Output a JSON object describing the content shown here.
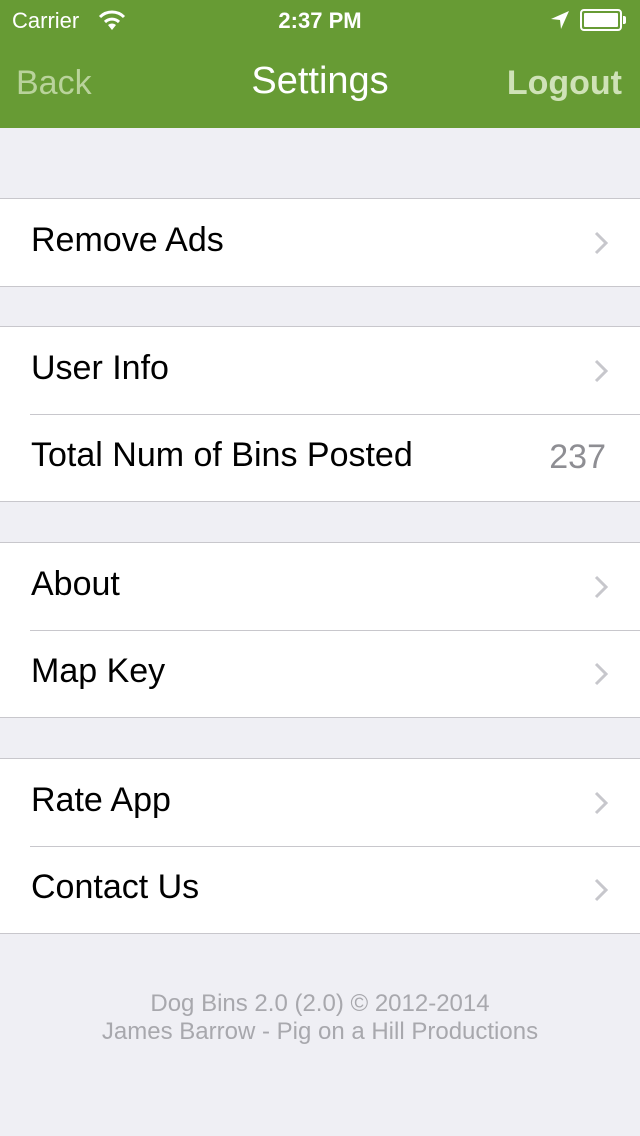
{
  "status_bar": {
    "carrier": "Carrier",
    "time": "2:37 PM",
    "icons": [
      "wifi-icon",
      "location-arrow-icon",
      "battery-icon"
    ]
  },
  "nav": {
    "back_label": "Back",
    "title": "Settings",
    "logout_label": "Logout",
    "bar_color": "#679b34"
  },
  "groups": [
    {
      "rows": [
        {
          "label": "Remove Ads",
          "accessory": "chevron-right-icon"
        }
      ]
    },
    {
      "rows": [
        {
          "label": "User Info",
          "accessory": "chevron-right-icon"
        },
        {
          "label": "Total Num of Bins Posted",
          "value": "237"
        }
      ]
    },
    {
      "rows": [
        {
          "label": "About",
          "accessory": "chevron-right-icon"
        },
        {
          "label": "Map Key",
          "accessory": "chevron-right-icon"
        }
      ]
    },
    {
      "rows": [
        {
          "label": "Rate App",
          "accessory": "chevron-right-icon"
        },
        {
          "label": "Contact Us",
          "accessory": "chevron-right-icon"
        }
      ]
    }
  ],
  "footer": {
    "line1": "Dog Bins 2.0 (2.0) © 2012-2014",
    "line2": "James Barrow - Pig on a Hill Productions"
  }
}
